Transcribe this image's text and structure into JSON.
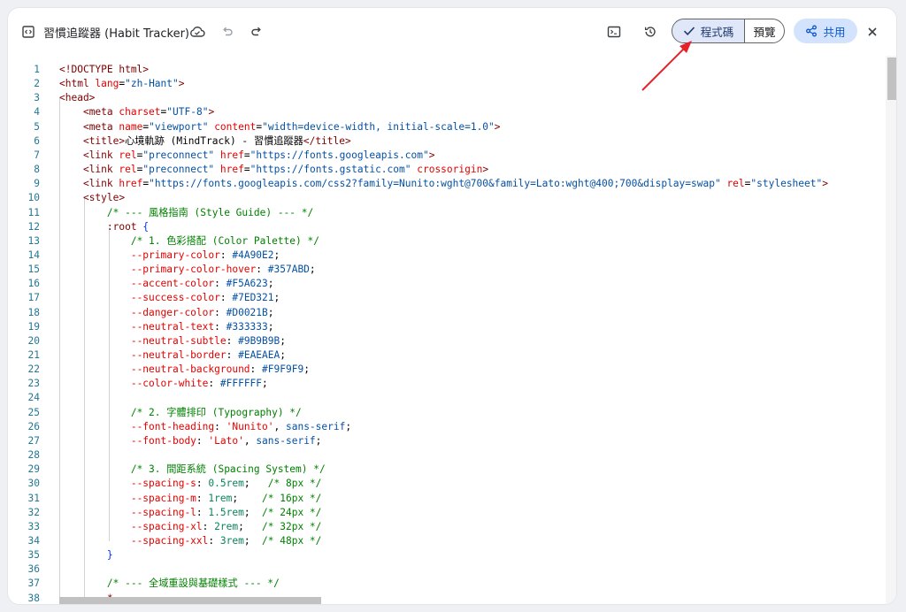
{
  "toolbar": {
    "title": "習慣追蹤器 (Habit Tracker)",
    "code_label": "程式碼",
    "preview_label": "預覽",
    "share_label": "共用"
  },
  "editor": {
    "lines": [
      [
        [
          "t-tag",
          "<!DOCTYPE html>"
        ]
      ],
      [
        [
          "t-tag",
          "<html "
        ],
        [
          "t-attr",
          "lang"
        ],
        [
          "t-plain",
          "="
        ],
        [
          "t-str",
          "\"zh-Hant\""
        ],
        [
          "t-tag",
          ">"
        ]
      ],
      [
        [
          "t-tag",
          "<head>"
        ]
      ],
      [
        [
          "t-plain",
          "    "
        ],
        [
          "t-tag",
          "<meta "
        ],
        [
          "t-attr",
          "charset"
        ],
        [
          "t-plain",
          "="
        ],
        [
          "t-str",
          "\"UTF-8\""
        ],
        [
          "t-tag",
          ">"
        ]
      ],
      [
        [
          "t-plain",
          "    "
        ],
        [
          "t-tag",
          "<meta "
        ],
        [
          "t-attr",
          "name"
        ],
        [
          "t-plain",
          "="
        ],
        [
          "t-str",
          "\"viewport\""
        ],
        [
          "t-plain",
          " "
        ],
        [
          "t-attr",
          "content"
        ],
        [
          "t-plain",
          "="
        ],
        [
          "t-str",
          "\"width=device-width, initial-scale=1.0\""
        ],
        [
          "t-tag",
          ">"
        ]
      ],
      [
        [
          "t-plain",
          "    "
        ],
        [
          "t-tag",
          "<title>"
        ],
        [
          "t-plain",
          "心境軌跡 (MindTrack) - 習慣追蹤器"
        ],
        [
          "t-tag",
          "</title>"
        ]
      ],
      [
        [
          "t-plain",
          "    "
        ],
        [
          "t-tag",
          "<link "
        ],
        [
          "t-attr",
          "rel"
        ],
        [
          "t-plain",
          "="
        ],
        [
          "t-str",
          "\"preconnect\""
        ],
        [
          "t-plain",
          " "
        ],
        [
          "t-attr",
          "href"
        ],
        [
          "t-plain",
          "="
        ],
        [
          "t-str",
          "\"https://fonts.googleapis.com\""
        ],
        [
          "t-tag",
          ">"
        ]
      ],
      [
        [
          "t-plain",
          "    "
        ],
        [
          "t-tag",
          "<link "
        ],
        [
          "t-attr",
          "rel"
        ],
        [
          "t-plain",
          "="
        ],
        [
          "t-str",
          "\"preconnect\""
        ],
        [
          "t-plain",
          " "
        ],
        [
          "t-attr",
          "href"
        ],
        [
          "t-plain",
          "="
        ],
        [
          "t-str",
          "\"https://fonts.gstatic.com\""
        ],
        [
          "t-plain",
          " "
        ],
        [
          "t-attr",
          "crossorigin"
        ],
        [
          "t-tag",
          ">"
        ]
      ],
      [
        [
          "t-plain",
          "    "
        ],
        [
          "t-tag",
          "<link "
        ],
        [
          "t-attr",
          "href"
        ],
        [
          "t-plain",
          "="
        ],
        [
          "t-str",
          "\"https://fonts.googleapis.com/css2?family=Nunito:wght@700&family=Lato:wght@400;700&display=swap\""
        ],
        [
          "t-plain",
          " "
        ],
        [
          "t-attr",
          "rel"
        ],
        [
          "t-plain",
          "="
        ],
        [
          "t-str",
          "\"stylesheet\""
        ],
        [
          "t-tag",
          ">"
        ]
      ],
      [
        [
          "t-plain",
          "    "
        ],
        [
          "t-tag",
          "<style>"
        ]
      ],
      [
        [
          "t-plain",
          "        "
        ],
        [
          "t-cm",
          "/* --- 風格指南 (Style Guide) --- */"
        ]
      ],
      [
        [
          "t-plain",
          "        "
        ],
        [
          "t-sel",
          ":root"
        ],
        [
          "t-plain",
          " "
        ],
        [
          "t-brace",
          "{"
        ]
      ],
      [
        [
          "t-plain",
          "            "
        ],
        [
          "t-cm",
          "/* 1. 色彩搭配 (Color Palette) */"
        ]
      ],
      [
        [
          "t-plain",
          "            "
        ],
        [
          "t-prop",
          "--primary-color"
        ],
        [
          "t-plain",
          ": "
        ],
        [
          "t-str",
          "#4A90E2"
        ],
        [
          "t-plain",
          ";"
        ]
      ],
      [
        [
          "t-plain",
          "            "
        ],
        [
          "t-prop",
          "--primary-color-hover"
        ],
        [
          "t-plain",
          ": "
        ],
        [
          "t-str",
          "#357ABD"
        ],
        [
          "t-plain",
          ";"
        ]
      ],
      [
        [
          "t-plain",
          "            "
        ],
        [
          "t-prop",
          "--accent-color"
        ],
        [
          "t-plain",
          ": "
        ],
        [
          "t-str",
          "#F5A623"
        ],
        [
          "t-plain",
          ";"
        ]
      ],
      [
        [
          "t-plain",
          "            "
        ],
        [
          "t-prop",
          "--success-color"
        ],
        [
          "t-plain",
          ": "
        ],
        [
          "t-str",
          "#7ED321"
        ],
        [
          "t-plain",
          ";"
        ]
      ],
      [
        [
          "t-plain",
          "            "
        ],
        [
          "t-prop",
          "--danger-color"
        ],
        [
          "t-plain",
          ": "
        ],
        [
          "t-str",
          "#D0021B"
        ],
        [
          "t-plain",
          ";"
        ]
      ],
      [
        [
          "t-plain",
          "            "
        ],
        [
          "t-prop",
          "--neutral-text"
        ],
        [
          "t-plain",
          ": "
        ],
        [
          "t-str",
          "#333333"
        ],
        [
          "t-plain",
          ";"
        ]
      ],
      [
        [
          "t-plain",
          "            "
        ],
        [
          "t-prop",
          "--neutral-subtle"
        ],
        [
          "t-plain",
          ": "
        ],
        [
          "t-str",
          "#9B9B9B"
        ],
        [
          "t-plain",
          ";"
        ]
      ],
      [
        [
          "t-plain",
          "            "
        ],
        [
          "t-prop",
          "--neutral-border"
        ],
        [
          "t-plain",
          ": "
        ],
        [
          "t-str",
          "#EAEAEA"
        ],
        [
          "t-plain",
          ";"
        ]
      ],
      [
        [
          "t-plain",
          "            "
        ],
        [
          "t-prop",
          "--neutral-background"
        ],
        [
          "t-plain",
          ": "
        ],
        [
          "t-str",
          "#F9F9F9"
        ],
        [
          "t-plain",
          ";"
        ]
      ],
      [
        [
          "t-plain",
          "            "
        ],
        [
          "t-prop",
          "--color-white"
        ],
        [
          "t-plain",
          ": "
        ],
        [
          "t-str",
          "#FFFFFF"
        ],
        [
          "t-plain",
          ";"
        ]
      ],
      [],
      [
        [
          "t-plain",
          "            "
        ],
        [
          "t-cm",
          "/* 2. 字體排印 (Typography) */"
        ]
      ],
      [
        [
          "t-plain",
          "            "
        ],
        [
          "t-prop",
          "--font-heading"
        ],
        [
          "t-plain",
          ": "
        ],
        [
          "t-attr",
          "'Nunito'"
        ],
        [
          "t-plain",
          ", "
        ],
        [
          "t-str",
          "sans-serif"
        ],
        [
          "t-plain",
          ";"
        ]
      ],
      [
        [
          "t-plain",
          "            "
        ],
        [
          "t-prop",
          "--font-body"
        ],
        [
          "t-plain",
          ": "
        ],
        [
          "t-attr",
          "'Lato'"
        ],
        [
          "t-plain",
          ", "
        ],
        [
          "t-str",
          "sans-serif"
        ],
        [
          "t-plain",
          ";"
        ]
      ],
      [],
      [
        [
          "t-plain",
          "            "
        ],
        [
          "t-cm",
          "/* 3. 間距系統 (Spacing System) */"
        ]
      ],
      [
        [
          "t-plain",
          "            "
        ],
        [
          "t-prop",
          "--spacing-s"
        ],
        [
          "t-plain",
          ": "
        ],
        [
          "t-num",
          "0.5rem"
        ],
        [
          "t-plain",
          ";   "
        ],
        [
          "t-cm",
          "/* 8px */"
        ]
      ],
      [
        [
          "t-plain",
          "            "
        ],
        [
          "t-prop",
          "--spacing-m"
        ],
        [
          "t-plain",
          ": "
        ],
        [
          "t-num",
          "1rem"
        ],
        [
          "t-plain",
          ";    "
        ],
        [
          "t-cm",
          "/* 16px */"
        ]
      ],
      [
        [
          "t-plain",
          "            "
        ],
        [
          "t-prop",
          "--spacing-l"
        ],
        [
          "t-plain",
          ": "
        ],
        [
          "t-num",
          "1.5rem"
        ],
        [
          "t-plain",
          ";  "
        ],
        [
          "t-cm",
          "/* 24px */"
        ]
      ],
      [
        [
          "t-plain",
          "            "
        ],
        [
          "t-prop",
          "--spacing-xl"
        ],
        [
          "t-plain",
          ": "
        ],
        [
          "t-num",
          "2rem"
        ],
        [
          "t-plain",
          ";   "
        ],
        [
          "t-cm",
          "/* 32px */"
        ]
      ],
      [
        [
          "t-plain",
          "            "
        ],
        [
          "t-prop",
          "--spacing-xxl"
        ],
        [
          "t-plain",
          ": "
        ],
        [
          "t-num",
          "3rem"
        ],
        [
          "t-plain",
          ";  "
        ],
        [
          "t-cm",
          "/* 48px */"
        ]
      ],
      [
        [
          "t-plain",
          "        "
        ],
        [
          "t-brace",
          "}"
        ]
      ],
      [],
      [
        [
          "t-plain",
          "        "
        ],
        [
          "t-cm",
          "/* --- 全域重設與基礎樣式 --- */"
        ]
      ],
      [
        [
          "t-plain",
          "        "
        ],
        [
          "t-sel",
          "*"
        ],
        [
          "t-plain",
          ","
        ]
      ]
    ]
  },
  "colors": {
    "accent": "#0b57d0",
    "annotation_arrow": "#e8202a"
  }
}
